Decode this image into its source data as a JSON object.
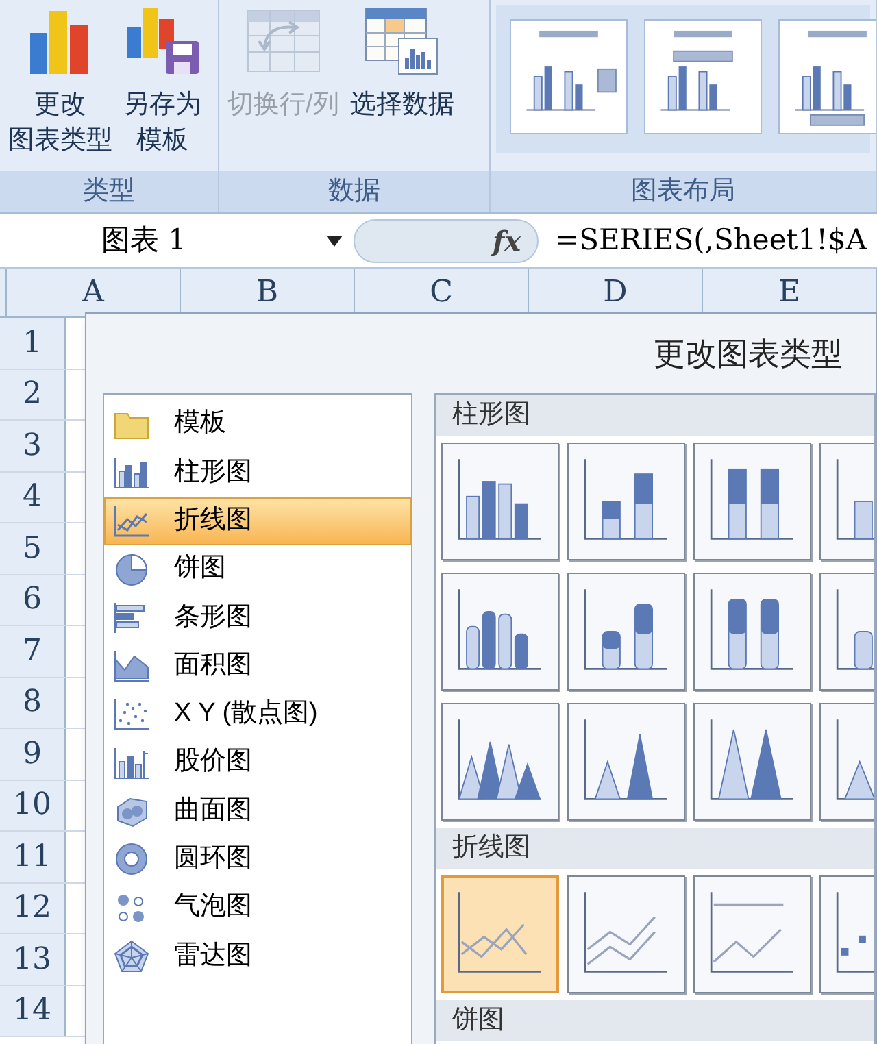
{
  "ribbon": {
    "groups": [
      {
        "label": "类型",
        "buttons": [
          {
            "kind": "chart",
            "lines": [
              "更改",
              "图表类型"
            ],
            "disabled": false
          },
          {
            "kind": "save",
            "lines": [
              "另存为",
              "模板"
            ],
            "disabled": false
          }
        ]
      },
      {
        "label": "数据",
        "buttons": [
          {
            "kind": "switch",
            "lines": [
              "切换行/列"
            ],
            "disabled": true
          },
          {
            "kind": "table",
            "lines": [
              "选择数据"
            ],
            "disabled": false
          }
        ]
      },
      {
        "label": "图表布局",
        "layouts": [
          {
            "kind": "legend-right"
          },
          {
            "kind": "legend-top"
          },
          {
            "kind": "legend-bottom"
          }
        ]
      }
    ]
  },
  "formula_bar": {
    "name_box": "图表 1",
    "fx": "fx",
    "formula": "=SERIES(,Sheet1!$A"
  },
  "sheet": {
    "columns": [
      "A",
      "B",
      "C",
      "D",
      "E"
    ],
    "rows": [
      "1",
      "2",
      "3",
      "4",
      "5",
      "6",
      "7",
      "8",
      "9",
      "10",
      "11",
      "12",
      "13",
      "14"
    ]
  },
  "dialog": {
    "title": "更改图表类型",
    "categories": [
      {
        "kind": "folder",
        "label": "模板",
        "selected": false
      },
      {
        "kind": "column",
        "label": "柱形图",
        "selected": false
      },
      {
        "kind": "line",
        "label": "折线图",
        "selected": true
      },
      {
        "kind": "pie",
        "label": "饼图",
        "selected": false
      },
      {
        "kind": "bar",
        "label": "条形图",
        "selected": false
      },
      {
        "kind": "area",
        "label": "面积图",
        "selected": false
      },
      {
        "kind": "scatter",
        "label": "X Y (散点图)",
        "selected": false
      },
      {
        "kind": "stock",
        "label": "股价图",
        "selected": false
      },
      {
        "kind": "surface",
        "label": "曲面图",
        "selected": false
      },
      {
        "kind": "doughnut",
        "label": "圆环图",
        "selected": false
      },
      {
        "kind": "bubble",
        "label": "气泡图",
        "selected": false
      },
      {
        "kind": "radar",
        "label": "雷达图",
        "selected": false
      }
    ],
    "sections": [
      {
        "label": "柱形图",
        "thumbnails": [
          {
            "kind": "column",
            "selected": false
          },
          {
            "kind": "column",
            "selected": false
          },
          {
            "kind": "column",
            "selected": false
          },
          {
            "kind": "column",
            "selected": false
          },
          {
            "kind": "cylinder",
            "selected": false
          },
          {
            "kind": "cylinder",
            "selected": false
          },
          {
            "kind": "cylinder",
            "selected": false
          },
          {
            "kind": "cylinder",
            "selected": false
          },
          {
            "kind": "cone",
            "selected": false
          },
          {
            "kind": "cone",
            "selected": false
          },
          {
            "kind": "pyramid",
            "selected": false
          },
          {
            "kind": "pyramid",
            "selected": false
          }
        ]
      },
      {
        "label": "折线图",
        "thumbnails": [
          {
            "kind": "line",
            "selected": true
          },
          {
            "kind": "line",
            "selected": false
          },
          {
            "kind": "line",
            "selected": false
          },
          {
            "kind": "line-markers",
            "selected": false
          }
        ]
      },
      {
        "label": "饼图"
      }
    ]
  }
}
